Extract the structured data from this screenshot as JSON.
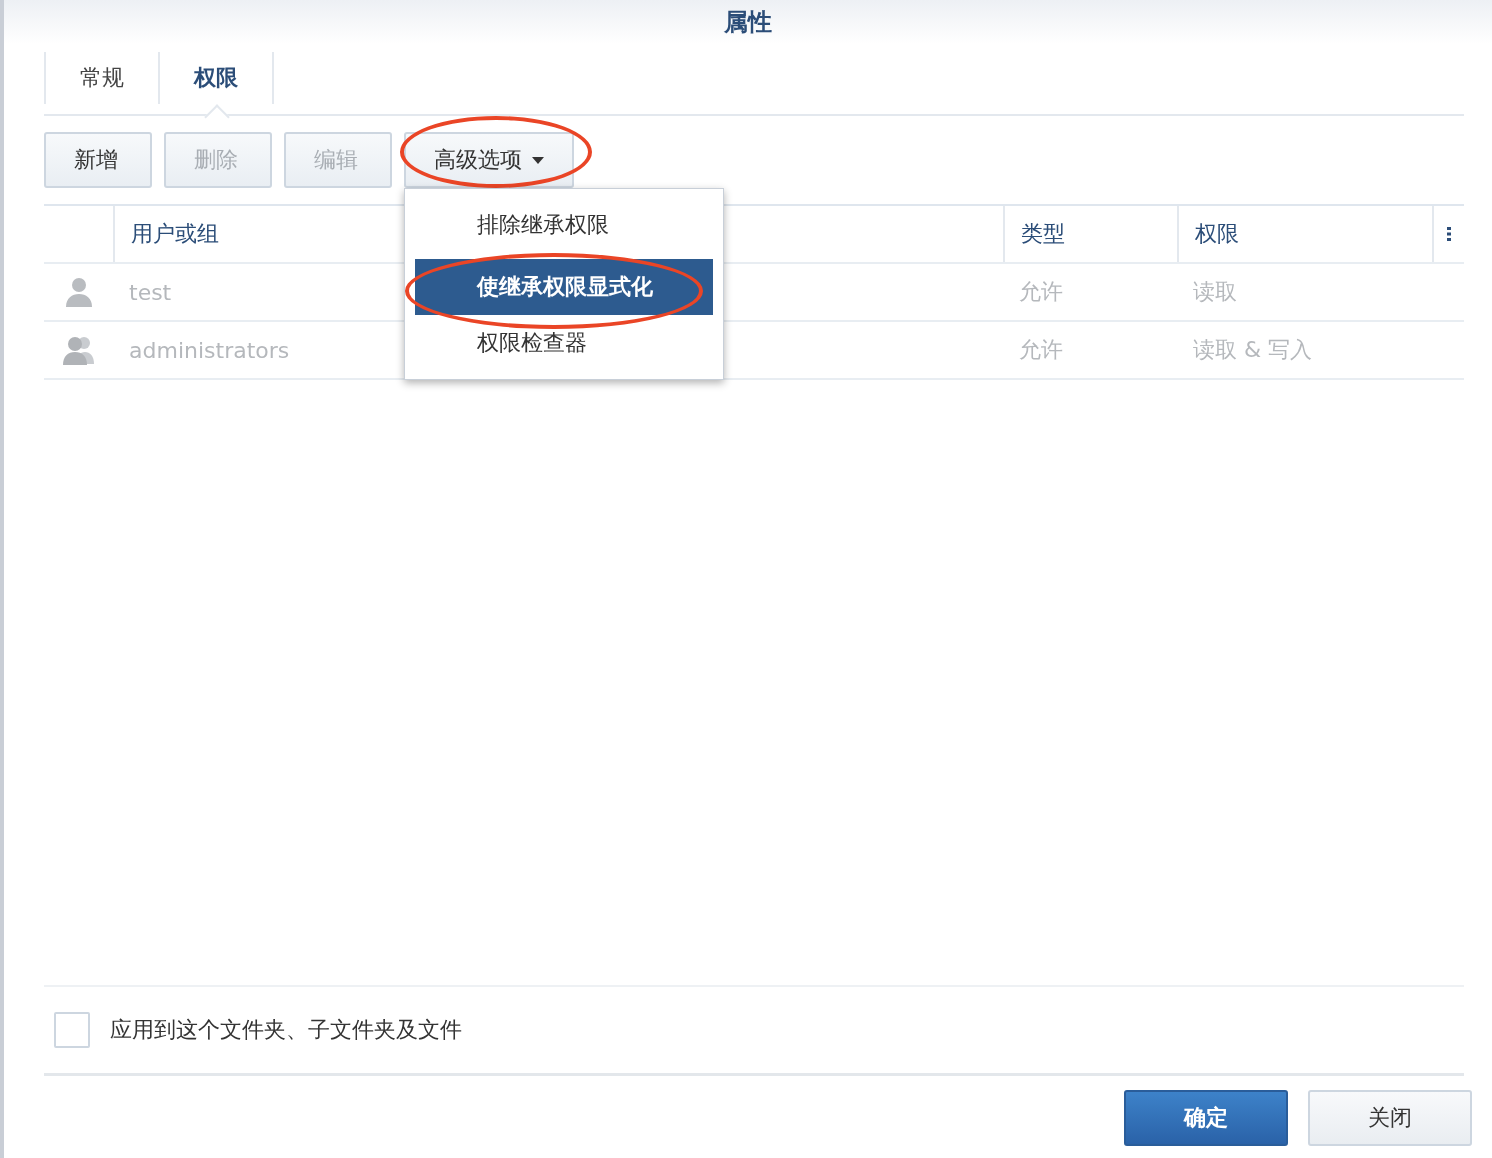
{
  "window": {
    "title": "属性"
  },
  "tabs": [
    {
      "label": "常规",
      "selected": false
    },
    {
      "label": "权限",
      "selected": true
    }
  ],
  "toolbar": [
    {
      "label": "新增",
      "disabled": false,
      "dropdown": false,
      "circled": false
    },
    {
      "label": "删除",
      "disabled": true,
      "dropdown": false,
      "circled": false
    },
    {
      "label": "编辑",
      "disabled": true,
      "dropdown": false,
      "circled": false
    },
    {
      "label": "高级选项",
      "disabled": false,
      "dropdown": true,
      "circled": true
    }
  ],
  "dropdown_menu": {
    "items": [
      {
        "label": "排除继承权限",
        "selected": false,
        "circled": false
      },
      {
        "label": "使继承权限显式化",
        "selected": true,
        "circled": true
      },
      {
        "label": "权限检查器",
        "selected": false,
        "circled": false
      }
    ]
  },
  "table": {
    "columns": [
      "用户或组",
      "类型",
      "权限"
    ],
    "rows": [
      {
        "kind": "user",
        "inherited": true,
        "cells": [
          "test",
          "允许",
          "读取"
        ]
      },
      {
        "kind": "group",
        "inherited": true,
        "cells": [
          "administrators",
          "允许",
          "读取 & 写入"
        ]
      }
    ]
  },
  "apply_option": {
    "label": "应用到这个文件夹、子文件夹及文件",
    "checked": false
  },
  "buttons": [
    {
      "label": "确定",
      "kind": "primary"
    },
    {
      "label": "关闭",
      "kind": "secondary"
    }
  ]
}
